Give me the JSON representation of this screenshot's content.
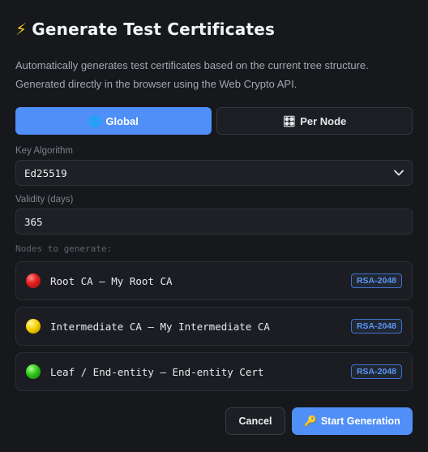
{
  "dialog": {
    "title": "Generate Test Certificates",
    "title_icon": "⚡",
    "description_line1": "Automatically generates test certificates based on the current tree structure.",
    "description_line2": "Generated directly in the browser using the Web Crypto API."
  },
  "mode_tabs": [
    {
      "label": "Global",
      "icon": "globe-icon",
      "glyph": "🌐",
      "active": true
    },
    {
      "label": "Per Node",
      "icon": "grid-icon",
      "glyph": "🎛",
      "active": false
    }
  ],
  "key_algorithm": {
    "label": "Key Algorithm",
    "value": "Ed25519"
  },
  "validity": {
    "label": "Validity (days)",
    "value": "365"
  },
  "nodes": {
    "label": "Nodes to generate:",
    "items": [
      {
        "text": "Root CA — My Root CA",
        "status_color": "red",
        "algorithm": "RSA-2048"
      },
      {
        "text": "Intermediate CA — My Intermediate CA",
        "status_color": "yellow",
        "algorithm": "RSA-2048"
      },
      {
        "text": "Leaf / End-entity — End-entity Cert",
        "status_color": "green",
        "algorithm": "RSA-2048"
      }
    ]
  },
  "actions": {
    "cancel_label": "Cancel",
    "start_label": "Start Generation",
    "start_icon": "key-icon",
    "start_glyph": "🔑"
  },
  "colors": {
    "accent": "#4f8ff7",
    "background": "#17181c",
    "badge": "#5b95f0"
  }
}
